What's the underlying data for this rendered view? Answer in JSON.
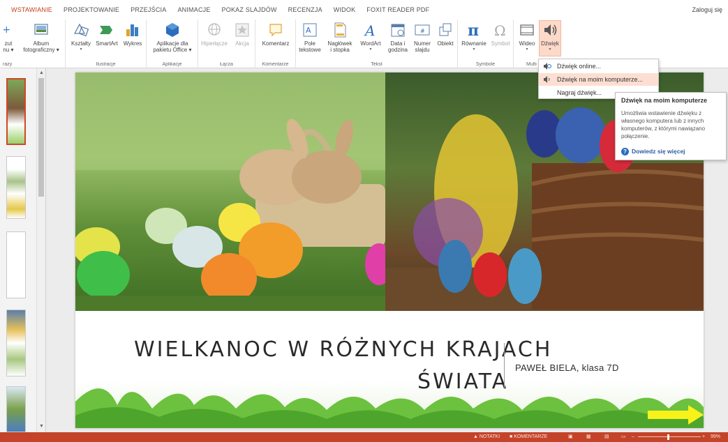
{
  "tabs": [
    "WSTAWIANIE",
    "PROJEKTOWANIE",
    "PRZEJŚCIA",
    "ANIMACJE",
    "POKAZ SLAJDÓW",
    "RECENZJA",
    "WIDOK",
    "FOXIT READER PDF"
  ],
  "active_tab": "WSTAWIANIE",
  "login": "Zaloguj się",
  "ribbon": {
    "groups": {
      "obrazy": "razy",
      "ilustracje": "Ilustracje",
      "aplikacje": "Aplikacje",
      "lacza": "Łącza",
      "komentarze": "Komentarze",
      "tekst": "Tekst",
      "symbole": "Symbole",
      "multimedia": "Multi"
    },
    "commands": {
      "zrzut": [
        "zut",
        "nu ▾"
      ],
      "album": [
        "Album",
        "fotograficzny ▾"
      ],
      "ksztalty": [
        "Kształty"
      ],
      "smartart": [
        "SmartArt"
      ],
      "wykres": [
        "Wykres"
      ],
      "aplikacje_dla": [
        "Aplikacje dla",
        "pakietu Office ▾"
      ],
      "hiperlacze": [
        "Hiperłącze"
      ],
      "akcja": [
        "Akcja"
      ],
      "komentarz": [
        "Komentarz"
      ],
      "pole": [
        "Pole",
        "tekstowe"
      ],
      "naglowek": [
        "Nagłówek",
        "i stopka"
      ],
      "wordart": [
        "WordArt"
      ],
      "data": [
        "Data i",
        "godzina"
      ],
      "numer": [
        "Numer",
        "slajdu"
      ],
      "obiekt": [
        "Obiekt"
      ],
      "rownanie": [
        "Równanie"
      ],
      "symbol": [
        "Symbol"
      ],
      "wideo": [
        "Wideo"
      ],
      "dzwiek": [
        "Dźwięk"
      ]
    }
  },
  "menu": {
    "items": [
      "Dźwięk online...",
      "Dźwięk na moim komputerze...",
      "Nagraj dźwięk..."
    ],
    "highlighted": 1
  },
  "tooltip": {
    "title": "Dźwięk na moim komputerze",
    "body": "Umożliwia wstawienie dźwięku z własnego komputera lub z innych komputerów, z którymi nawiązano połączenie.",
    "link": "Dowiedz się więcej"
  },
  "slide": {
    "title_line1": "WIELKANOC W RÓŻNYCH KRAJACH",
    "title_line2": "ŚWIATA",
    "author": "PAWEŁ BIELA, klasa 7D"
  },
  "status": {
    "notes": "NOTATKI",
    "comments": "KOMENTARZE",
    "zoom": "99%"
  },
  "colors": {
    "accent": "#c43e1c",
    "statusbar": "#c4442a",
    "menu_highlight": "#fcdfd2",
    "arrow": "#f7f21a"
  }
}
